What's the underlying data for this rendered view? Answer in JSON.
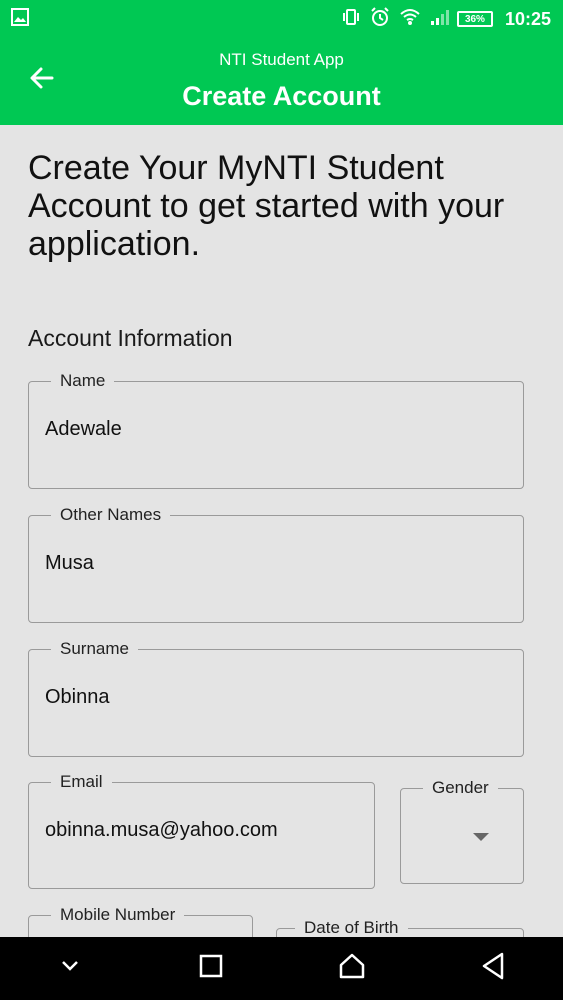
{
  "status_bar": {
    "time": "10:25",
    "battery": "36%",
    "icons": [
      "image-icon",
      "vibrate-icon",
      "alarm-icon",
      "wifi-icon",
      "signal-icon",
      "battery-icon"
    ]
  },
  "app_bar": {
    "subtitle": "NTI Student App",
    "title": "Create Account",
    "back_icon": "arrow-left-icon",
    "color": "#00c853"
  },
  "main": {
    "headline": "Create Your MyNTI Student Account to get started with your application.",
    "section_title": "Account Information",
    "fields": {
      "name": {
        "label": "Name",
        "value": "Adewale"
      },
      "other_names": {
        "label": "Other Names",
        "value": "Musa"
      },
      "surname": {
        "label": "Surname",
        "value": "Obinna"
      },
      "email": {
        "label": "Email",
        "value": "obinna.musa@yahoo.com"
      },
      "gender": {
        "label": "Gender",
        "value": ""
      },
      "mobile": {
        "label": "Mobile Number",
        "value": ""
      },
      "dob": {
        "label": "Date of Birth",
        "value": ""
      }
    }
  },
  "nav_bar": {
    "icons": [
      "chevron-down-icon",
      "recents-icon",
      "home-icon",
      "back-triangle-icon"
    ]
  }
}
